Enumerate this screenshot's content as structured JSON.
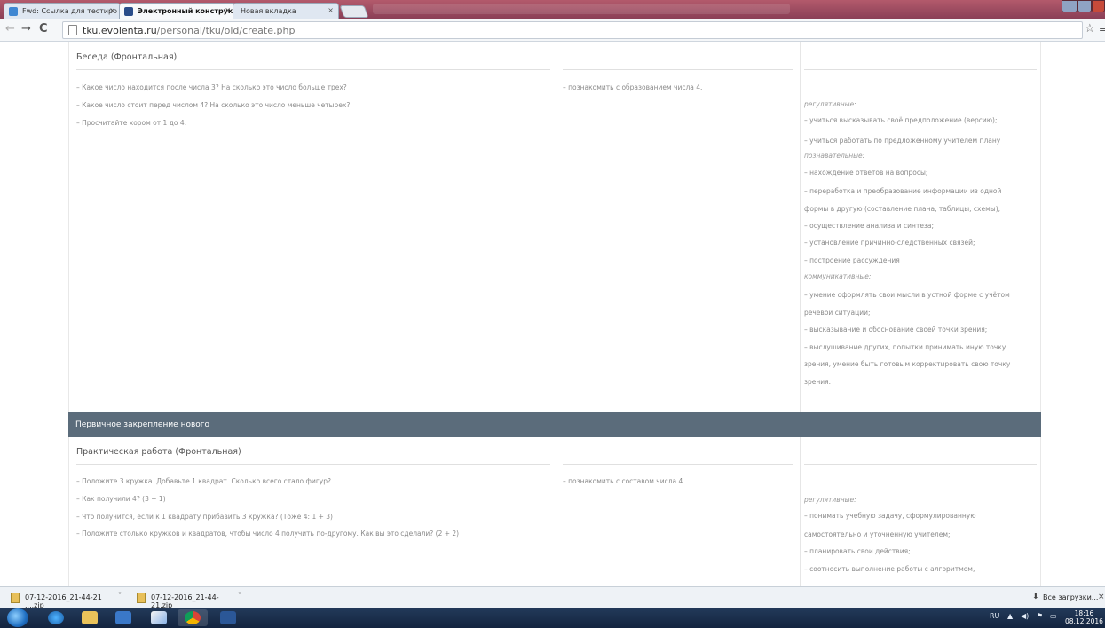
{
  "browser": {
    "tabs": [
      {
        "label": "Fwd: Ссылка для тестиро",
        "close": "×"
      },
      {
        "label": "Электронный конструкто",
        "close": "×"
      },
      {
        "label": "Новая вкладка",
        "close": "×"
      }
    ],
    "url_host": "tku.evolenta.ru",
    "url_path": "/personal/tku/old/create.php"
  },
  "sections": [
    {
      "title": "Беседа (Фронтальная)",
      "activities": [
        "– Какое число находится после числа 3? На сколько это число больше трех?",
        "– Какое число стоит перед числом 4? На сколько это число меньше четырех?",
        "– Просчитайте хором от 1 до 4."
      ],
      "goal": "– познакомить с образованием числа 4.",
      "uud": [
        {
          "text": "регулятивные:",
          "cat": true
        },
        {
          "text": "– учиться высказывать своё предположение (версию);"
        },
        {
          "text": "– учиться работать по предложенному учителем плану"
        },
        {
          "text": "познавательные:",
          "cat": true
        },
        {
          "text": "– нахождение ответов на вопросы;"
        },
        {
          "text": "– переработка и преобразование информации из одной"
        },
        {
          "text": "формы в другую (составление плана, таблицы, схемы);"
        },
        {
          "text": "– осуществление анализа и синтеза;"
        },
        {
          "text": "– установление причинно-следственных связей;"
        },
        {
          "text": "– построение рассуждения"
        },
        {
          "text": "коммуникативные:",
          "cat": true
        },
        {
          "text": "– умение оформлять свои мысли в устной форме с учётом"
        },
        {
          "text": "речевой ситуации;"
        },
        {
          "text": "– высказывание и обоснование своей точки зрения;"
        },
        {
          "text": "– выслушивание других, попытки принимать иную точку"
        },
        {
          "text": "зрения, умение быть готовым корректировать свою точку"
        },
        {
          "text": "зрения."
        }
      ]
    },
    {
      "stage": "Первичное закрепление нового",
      "title": "Практическая работа (Фронтальная)",
      "activities": [
        "– Положите 3 кружка. Добавьте 1 квадрат. Сколько всего стало фигур?",
        "– Как получили 4? (3 + 1)",
        "– Что получится, если к 1 квадрату прибавить 3 кружка? (Тоже 4: 1 + 3)",
        "– Положите столько кружков и квадратов, чтобы число 4 получить по-другому. Как вы это сделали? (2 + 2)"
      ],
      "goal": "– познакомить с составом числа 4.",
      "uud": [
        {
          "text": "регулятивные:",
          "cat": true
        },
        {
          "text": "– понимать учебную задачу, сформулированную"
        },
        {
          "text": "самостоятельно и уточненную учителем;"
        },
        {
          "text": "– планировать свои действия;"
        },
        {
          "text": "– соотносить выполнение работы с алгоритмом,"
        }
      ]
    }
  ],
  "downloads": {
    "items": [
      "07-12-2016_21-44-21 ....zip",
      "07-12-2016_21-44-21.zip"
    ],
    "all_label": "Все загрузки..."
  },
  "taskbar": {
    "lang": "RU",
    "time": "18:16",
    "date": "08.12.2016"
  }
}
